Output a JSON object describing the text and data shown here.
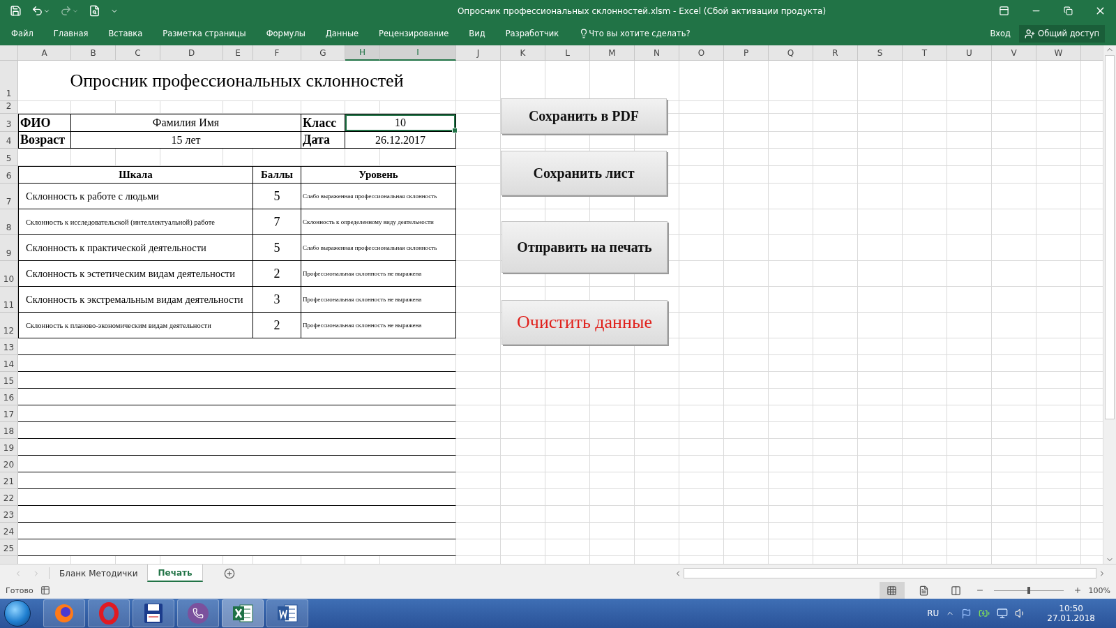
{
  "window": {
    "title": "Опросник профессиональных склонностей.xlsm - Excel (Сбой активации продукта)"
  },
  "ribbon": {
    "tabs": [
      {
        "label": "Файл"
      },
      {
        "label": "Главная"
      },
      {
        "label": "Вставка"
      },
      {
        "label": "Разметка страницы"
      },
      {
        "label": "Формулы"
      },
      {
        "label": "Данные"
      },
      {
        "label": "Рецензирование"
      },
      {
        "label": "Вид"
      },
      {
        "label": "Разработчик"
      }
    ],
    "tell_me": "Что вы хотите сделать?",
    "sign_in": "Вход",
    "share": "Общий доступ"
  },
  "columns": [
    {
      "label": "A",
      "selected": false
    },
    {
      "label": "B",
      "selected": false
    },
    {
      "label": "C",
      "selected": false
    },
    {
      "label": "D",
      "selected": false
    },
    {
      "label": "E",
      "selected": false
    },
    {
      "label": "F",
      "selected": false
    },
    {
      "label": "G",
      "selected": false
    },
    {
      "label": "H",
      "selected": true
    },
    {
      "label": "I",
      "selected": true
    },
    {
      "label": "J",
      "selected": false
    },
    {
      "label": "K",
      "selected": false
    },
    {
      "label": "L",
      "selected": false
    },
    {
      "label": "M",
      "selected": false
    },
    {
      "label": "N",
      "selected": false
    },
    {
      "label": "O",
      "selected": false
    },
    {
      "label": "P",
      "selected": false
    },
    {
      "label": "Q",
      "selected": false
    },
    {
      "label": "R",
      "selected": false
    },
    {
      "label": "S",
      "selected": false
    },
    {
      "label": "T",
      "selected": false
    },
    {
      "label": "U",
      "selected": false
    },
    {
      "label": "V",
      "selected": false
    },
    {
      "label": "W",
      "selected": false
    }
  ],
  "row_numbers": [
    "1",
    "2",
    "3",
    "4",
    "5",
    "6",
    "7",
    "8",
    "9",
    "10",
    "11",
    "12",
    "13",
    "14",
    "15",
    "16",
    "17",
    "18",
    "19",
    "20",
    "21",
    "22",
    "23",
    "24",
    "25"
  ],
  "sheet": {
    "title": "Опросник профессиональных склонностей",
    "info_rows": [
      {
        "label": "ФИО",
        "value": "Фамилия Имя",
        "label2": "Класс",
        "value2": "10",
        "selected": true
      },
      {
        "label": "Возраст",
        "value": "15 лет",
        "label2": "Дата",
        "value2": "26.12.2017",
        "selected": false
      }
    ],
    "table": {
      "columns": [
        "Шкала",
        "Баллы",
        "Уровень"
      ],
      "rows": [
        {
          "kind": "normal",
          "scale": "Склонность к работе с людьми",
          "score": "5",
          "level_text": "Слабо выраженная профессиональная склонность"
        },
        {
          "kind": "compact",
          "scale": "Склонность к исследовательской (интеллектуальной) работе",
          "score": "7",
          "level_text": "Склонность к определенному виду деятельности"
        },
        {
          "kind": "normal",
          "scale": "Склонность к практической деятельности",
          "score": "5",
          "level_text": "Слабо выраженная профессиональная склонность"
        },
        {
          "kind": "normal",
          "scale": "Склонность к эстетическим видам деятельности",
          "score": "2",
          "level_text": "Профессиональная склонность не выражена"
        },
        {
          "kind": "normal",
          "scale": "Склонность к экстремальным видам деятельности",
          "score": "3",
          "level_text": "Профессиональная склонность не выражена"
        },
        {
          "kind": "compact",
          "scale": "Склонность к планово-экономическим видам деятельности",
          "score": "2",
          "level_text": "Профессиональная склонность не выражена"
        }
      ]
    }
  },
  "buttons": [
    {
      "label": "Сохранить в PDF",
      "kind": "action",
      "color": "#111111"
    },
    {
      "label": "Сохранить лист",
      "kind": "action",
      "color": "#111111"
    },
    {
      "label": "Отправить на печать",
      "kind": "action",
      "color": "#111111"
    },
    {
      "label": "Очистить данные",
      "kind": "warning",
      "color": "#e0201b"
    }
  ],
  "sheet_tabs": [
    {
      "label": "Бланк Методички",
      "selected": false
    },
    {
      "label": "Печать",
      "selected": true
    }
  ],
  "status_bar": {
    "status": "Готово",
    "views": [
      {
        "kind": "normal",
        "selected": true
      },
      {
        "kind": "page_layout",
        "selected": false
      },
      {
        "kind": "page_break",
        "selected": false
      }
    ],
    "zoom_slider": {
      "level": 0.5
    },
    "zoom": "100%"
  },
  "taskbar": {
    "apps": [
      {
        "kind": "firefox",
        "selected": false
      },
      {
        "kind": "opera",
        "selected": false
      },
      {
        "kind": "floppy",
        "selected": false
      },
      {
        "kind": "viber",
        "selected": false
      },
      {
        "kind": "excel",
        "selected": true
      },
      {
        "kind": "word",
        "selected": false
      }
    ],
    "language": "RU",
    "time": "10:50",
    "date": "27.01.2018"
  }
}
